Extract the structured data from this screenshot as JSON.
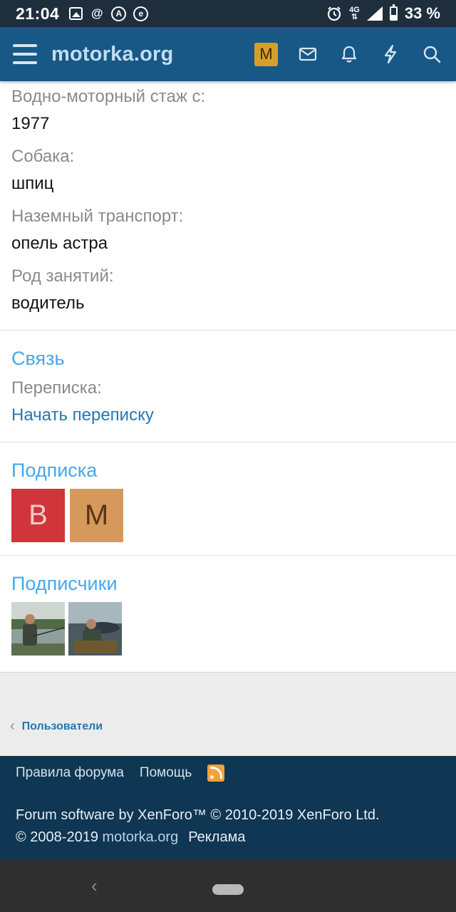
{
  "status_bar": {
    "time": "21:04",
    "network": "4G",
    "battery": "33 %",
    "icons": [
      "image-icon",
      "at-icon",
      "translate-icon",
      "browser-e-icon",
      "alarm-icon",
      "signal-icon",
      "battery-icon"
    ]
  },
  "header": {
    "site_name": "motorka.org",
    "user_avatar_letter": "M",
    "icons": [
      "menu-icon",
      "mail-icon",
      "bell-icon",
      "lightning-icon",
      "search-icon"
    ]
  },
  "profile_fields": [
    {
      "label": "Водно-моторный стаж с:",
      "value": "1977"
    },
    {
      "label": "Собака:",
      "value": "шпиц"
    },
    {
      "label": "Наземный транспорт:",
      "value": "опель астра"
    },
    {
      "label": "Род занятий:",
      "value": "водитель"
    }
  ],
  "contact": {
    "title": "Связь",
    "label": "Переписка:",
    "link": "Начать переписку"
  },
  "following": {
    "title": "Подписка",
    "avatars": [
      {
        "letter": "B",
        "bg": "#d1343a",
        "fg": "#f3c9c9"
      },
      {
        "letter": "M",
        "bg": "#d6995c",
        "fg": "#5a3510"
      }
    ]
  },
  "followers": {
    "title": "Подписчики"
  },
  "breadcrumb": {
    "back_label": "Пользователи"
  },
  "footer": {
    "links": [
      "Правила форума",
      "Помощь"
    ],
    "copyright_line1": "Forum software by XenForo™ © 2010-2019 XenForo Ltd.",
    "copyright_prefix": "© 2008-2019",
    "copyright_site": "motorka.org",
    "ads_link": "Реклама"
  },
  "colors": {
    "header_bg": "#185886",
    "accent_blue": "#47a7eb",
    "link_blue": "#2577b1",
    "footer_bg": "#0f3652"
  }
}
